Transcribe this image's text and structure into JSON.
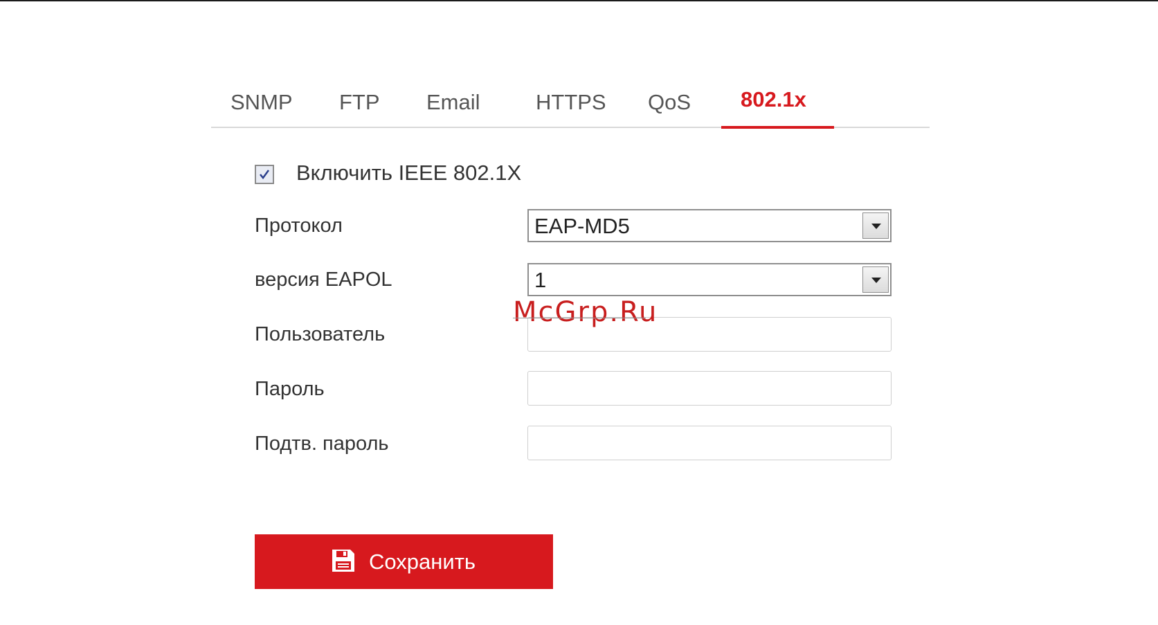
{
  "tabs": [
    "SNMP",
    "FTP",
    "Email",
    "HTTPS",
    "QoS",
    "802.1x"
  ],
  "active_tab": "802.1x",
  "form": {
    "enable_label": "Включить IEEE 802.1X",
    "enable_checked": true,
    "protocol_label": "Протокол",
    "protocol_value": "EAP-MD5",
    "eapol_label": "версия EAPOL",
    "eapol_value": "1",
    "user_label": "Пользователь",
    "user_value": "",
    "password_label": "Пароль",
    "password_value": "",
    "confirm_label": "Подтв. пароль",
    "confirm_value": ""
  },
  "save_label": "Сохранить",
  "watermark": "McGrp.Ru",
  "colors": {
    "accent": "#d7191e",
    "text": "#333333",
    "tab_inactive": "#555555"
  }
}
